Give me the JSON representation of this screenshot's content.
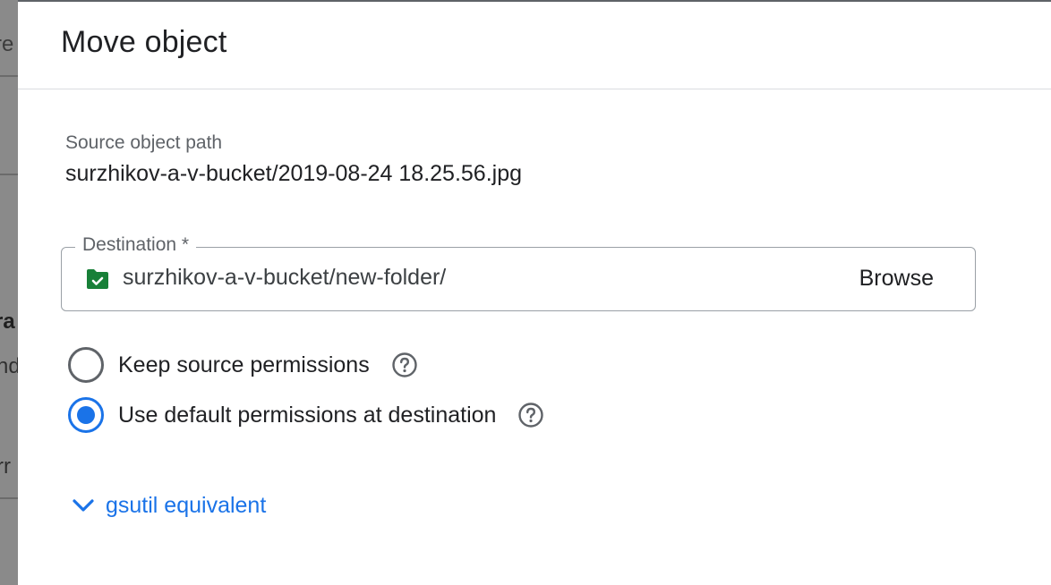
{
  "background": {
    "fragments": [
      "re",
      "ra",
      "nd",
      "rr"
    ]
  },
  "dialog": {
    "title": "Move object",
    "source": {
      "label": "Source object path",
      "value": "surzhikov-a-v-bucket/2019-08-24 18.25.56.jpg"
    },
    "destination": {
      "label": "Destination *",
      "value": "surzhikov-a-v-bucket/new-folder/",
      "icon": "folder-check-icon",
      "browse_label": "Browse"
    },
    "permissions": {
      "options": [
        {
          "label": "Keep source permissions",
          "checked": false,
          "help_icon": "help-icon"
        },
        {
          "label": "Use default permissions at destination",
          "checked": true,
          "help_icon": "help-icon"
        }
      ]
    },
    "gsutil": {
      "label": "gsutil equivalent",
      "icon": "chevron-down-icon"
    }
  },
  "colors": {
    "accent": "#1a73e8",
    "folder": "#188038",
    "text_primary": "#202124",
    "text_secondary": "#5f6368",
    "border": "#dadce0"
  }
}
